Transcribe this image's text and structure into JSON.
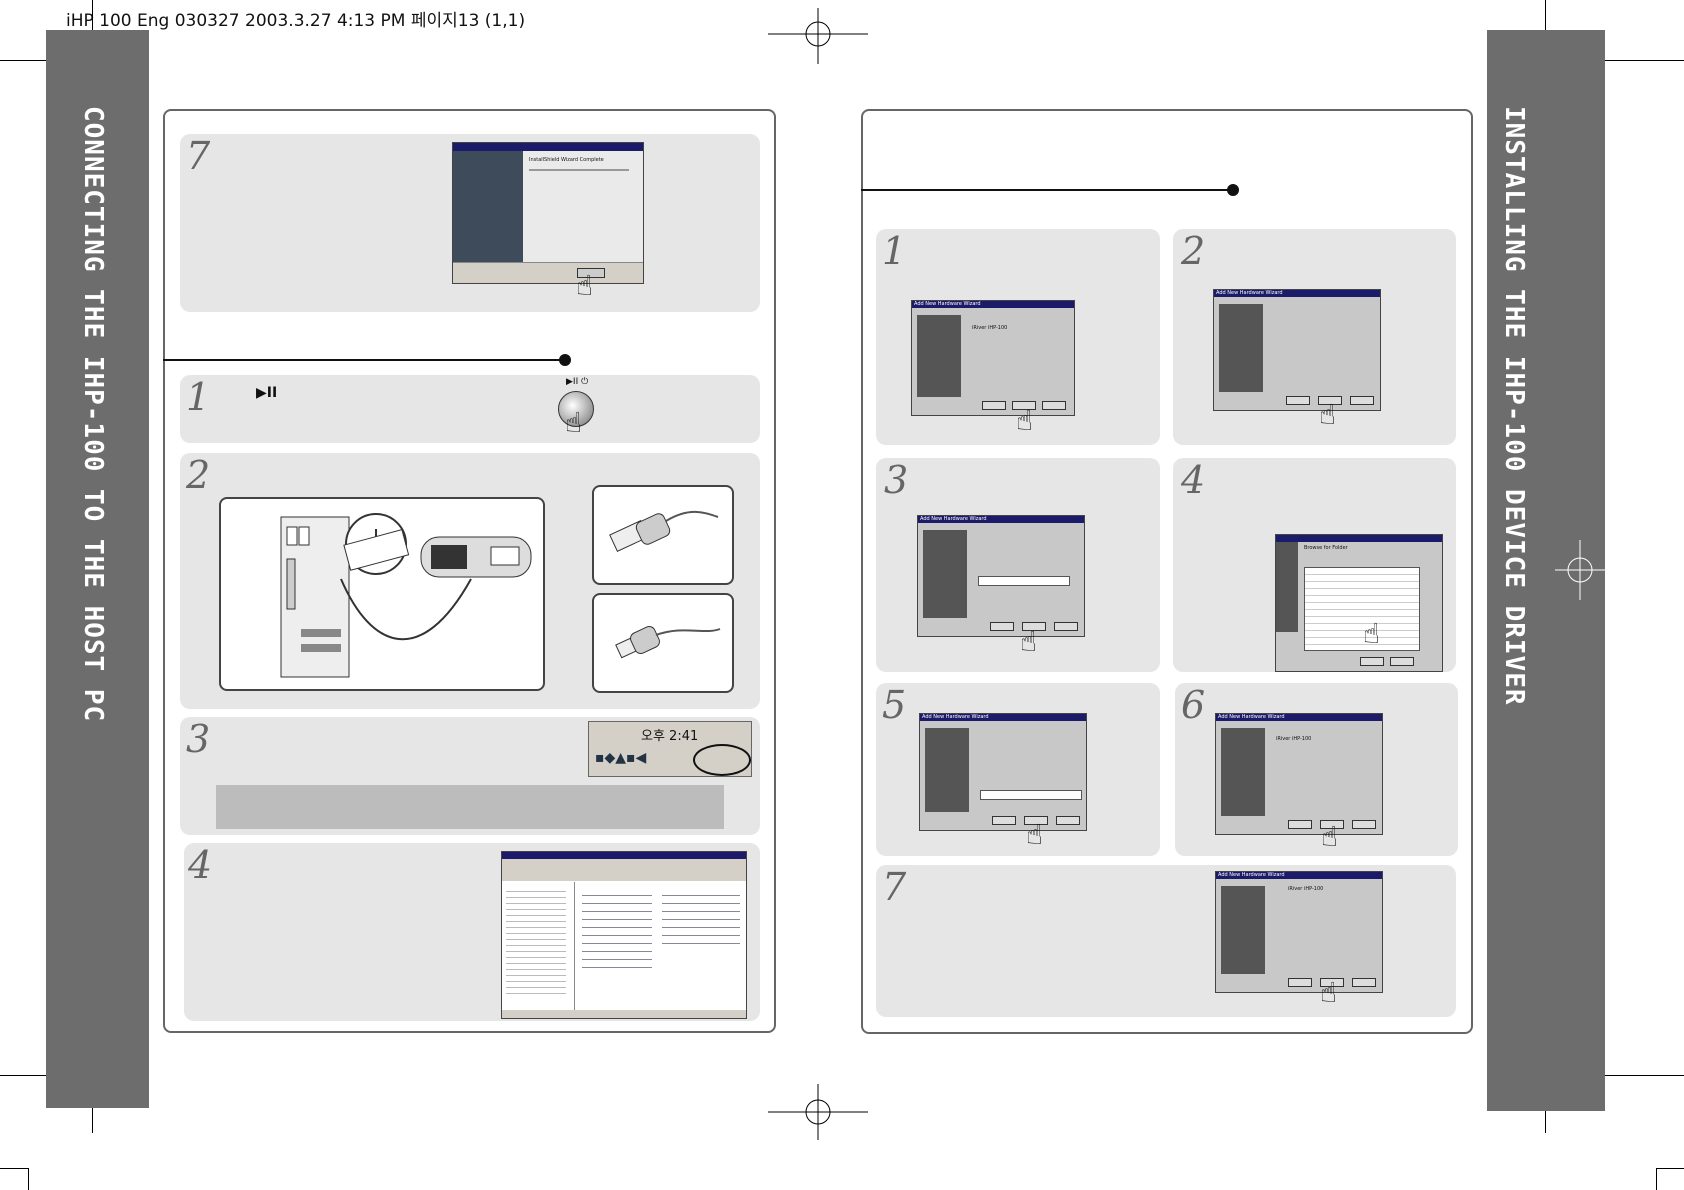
{
  "print_header": "iHP 100 Eng 030327 2003.3.27 4:13 PM 페이지13 (1,1)",
  "left_sidebar_title": "CONNECTING THE IHP-100 TO THE HOST PC",
  "right_sidebar_title": "INSTALLING THE IHP-100 DEVICE DRIVER",
  "left_page": {
    "step7_number": "7",
    "step1_number": "1",
    "step1_button_symbol": "▶II",
    "power_button_symbol": "▶II ⏻",
    "step2_number": "2",
    "step3_number": "3",
    "tray_time": "오후 2:41",
    "step4_number": "4",
    "install_wizard_title": "InstallShield Wizard",
    "install_complete_text": "InstallShield Wizard Complete"
  },
  "right_page": {
    "steps": [
      {
        "number": "1",
        "dialog_title": "Add New Hardware Wizard",
        "device": "iRiver iHP-100"
      },
      {
        "number": "2",
        "dialog_title": "Add New Hardware Wizard"
      },
      {
        "number": "3",
        "dialog_title": "Add New Hardware Wizard"
      },
      {
        "number": "4",
        "dialog_title": "Browse for Folder"
      },
      {
        "number": "5",
        "dialog_title": "Add New Hardware Wizard"
      },
      {
        "number": "6",
        "dialog_title": "Add New Hardware Wizard",
        "device": "iRiver iHP-100"
      },
      {
        "number": "7",
        "dialog_title": "Add New Hardware Wizard",
        "device": "iRiver iHP-100"
      }
    ]
  },
  "colors": {
    "sidebar": "#6d6d6d",
    "step_bg": "#e6e6e6",
    "frame": "#666666"
  }
}
